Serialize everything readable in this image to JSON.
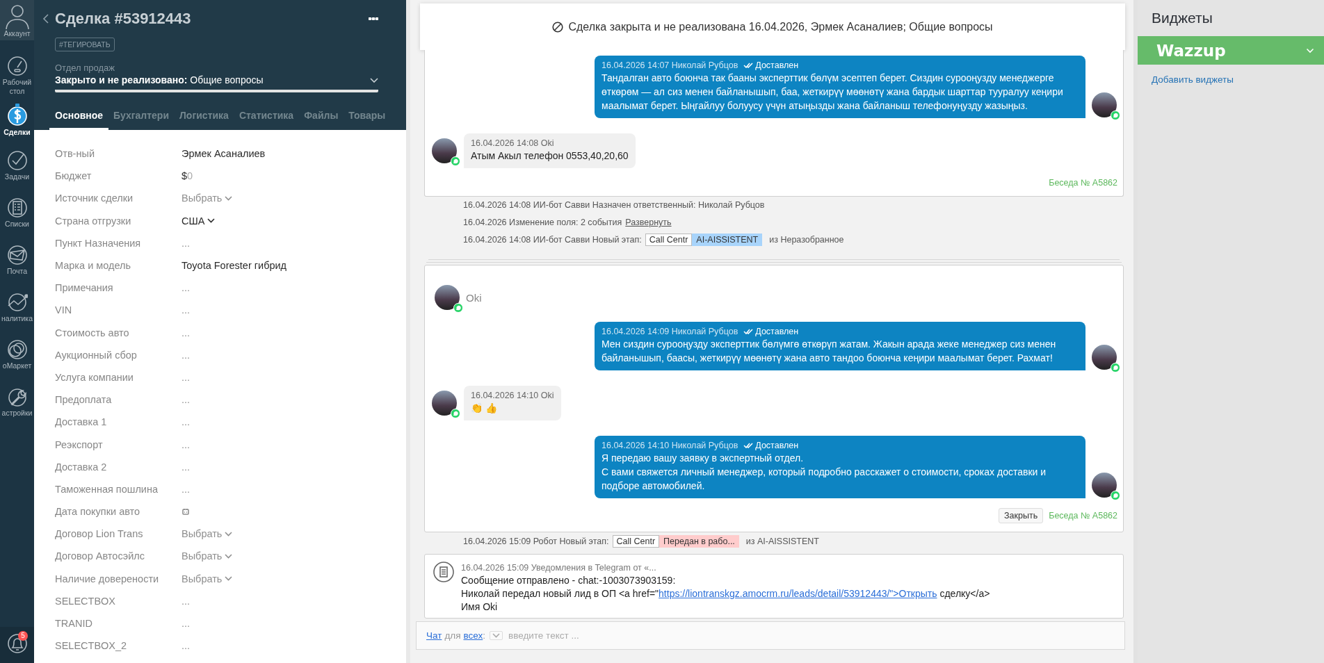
{
  "nav": {
    "items": [
      {
        "kind": "account",
        "label": "Аккаунт",
        "selected": false
      },
      {
        "kind": "dashboard",
        "label": "Рабочий стол",
        "selected": false
      },
      {
        "kind": "leads",
        "label": "Сделки",
        "selected": true
      },
      {
        "kind": "tasks",
        "label": "Задачи",
        "selected": false
      },
      {
        "kind": "lists",
        "label": "Списки",
        "selected": false
      },
      {
        "kind": "mail",
        "label": "Почта",
        "selected": false
      },
      {
        "kind": "analytics",
        "label": "налитика",
        "selected": false
      },
      {
        "kind": "market",
        "label": "оМаркет",
        "selected": false
      },
      {
        "kind": "settings",
        "label": "астройки",
        "selected": false
      }
    ],
    "notifications": {
      "badge": "5"
    }
  },
  "deal": {
    "title": "Сделка #53912443",
    "tag_button": "#ТЕГИРОВАТЬ",
    "pipeline": "Отдел продаж",
    "status": "**Закрыто и не реализовано:** Общие вопросы",
    "tabs": [
      {
        "label": "Основное",
        "selected": true
      },
      {
        "label": "Бухгалтери",
        "selected": false
      },
      {
        "label": "Логистика",
        "selected": false
      },
      {
        "label": "Статистика",
        "selected": false
      },
      {
        "label": "Файлы",
        "selected": false
      },
      {
        "label": "Товары",
        "selected": false
      }
    ],
    "fields": [
      {
        "label": "Отв-ный",
        "kind": "text",
        "value": "Эрмек Асаналиев"
      },
      {
        "label": "Бюджет",
        "kind": "money",
        "currency": "$",
        "value": "0"
      },
      {
        "label": "Источник сделки",
        "kind": "select_empty",
        "placeholder": "Выбрать"
      },
      {
        "label": "Страна отгрузки",
        "kind": "select",
        "value": "США"
      },
      {
        "label": "Пункт Назначения",
        "kind": "empty",
        "placeholder": "..."
      },
      {
        "label": "Марка и модель",
        "kind": "text",
        "value": "Toyota Forester гибрид"
      },
      {
        "label": "Примечания",
        "kind": "empty",
        "placeholder": "..."
      },
      {
        "label": "VIN",
        "kind": "empty",
        "placeholder": "..."
      },
      {
        "label": "Стоимость авто",
        "kind": "empty",
        "placeholder": "..."
      },
      {
        "label": "Аукционный сбор",
        "kind": "empty",
        "placeholder": "..."
      },
      {
        "label": "Услуга компании",
        "kind": "empty",
        "placeholder": "..."
      },
      {
        "label": "Предоплата",
        "kind": "empty",
        "placeholder": "..."
      },
      {
        "label": "Доставка 1",
        "kind": "empty",
        "placeholder": "..."
      },
      {
        "label": "Реэкспорт",
        "kind": "empty",
        "placeholder": "..."
      },
      {
        "label": "Доставка 2",
        "kind": "empty",
        "placeholder": "..."
      },
      {
        "label": "Таможенная пошлина",
        "kind": "empty",
        "placeholder": "..."
      },
      {
        "label": "Дата покупки авто",
        "kind": "date"
      },
      {
        "label": "Договор Lion Trans",
        "kind": "select_empty",
        "placeholder": "Выбрать"
      },
      {
        "label": "Договор Автосэйлс",
        "kind": "select_empty",
        "placeholder": "Выбрать"
      },
      {
        "label": "Наличие доверености",
        "kind": "select_empty",
        "placeholder": "Выбрать"
      },
      {
        "label": "SELECTBOX",
        "kind": "empty",
        "placeholder": "..."
      },
      {
        "label": "TRANID",
        "kind": "empty",
        "placeholder": "..."
      },
      {
        "label": "SELECTBOX_2",
        "kind": "empty",
        "placeholder": "..."
      }
    ]
  },
  "feed": {
    "notice": "Сделка закрыта и не реализована 16.04.2026, Эрмек Асаналиев; Общие вопросы",
    "items": [
      {
        "kind": "chat",
        "stacked": false,
        "messages": [
          {
            "kind": "outgoing",
            "meta": "16.04.2026 14:07 Николай Рубцов",
            "status": "Доставлен",
            "text": "Тандалган авто боюнча так бааны эксперттик бөлүм эсептеп берет. Сиздин сурооңузду менеджерге өткөрөм — ал сиз менен байланышып, баа, жеткирүү мөөнөтү жана бардык шарттар тууралуу кеңири маалымат берет. Ыңгайлуу болуусу үчүн атыңызды жана байланыш телефонуңузду жазыңыз."
          },
          {
            "kind": "incoming",
            "meta": "16.04.2026 14:08 Oki",
            "text": "Атым Акыл телефон 0553,40,20,60"
          }
        ],
        "conversation": "Беседа № A5862"
      },
      {
        "kind": "event",
        "text": "16.04.2026 14:08 ИИ-бот Савви Назначен ответственный: Николай Рубцов"
      },
      {
        "kind": "event",
        "text": "16.04.2026 Изменение поля: 2 события",
        "link": "Развернуть"
      },
      {
        "kind": "stage",
        "text": "16.04.2026 14:08 ИИ-бот Савви Новый этап:",
        "stages": [
          {
            "label": "Call Centr",
            "color": "#ffffff"
          },
          {
            "label": "AI-AISSISTENT",
            "color": "#a8d4fb"
          }
        ],
        "suffix": "из Неразобранное"
      },
      {
        "kind": "chat",
        "stacked": true,
        "contact": "Oki",
        "messages": [
          {
            "kind": "outgoing",
            "meta": "16.04.2026 14:09 Николай Рубцов",
            "status": "Доставлен",
            "text": "Мен сиздин сурооңузду эксперттик бөлүмгө өткөрүп жатам. Жакын арада жеке менеджер сиз менен байланышып, баасы, жеткирүү мөөнөтү жана авто тандоо боюнча кеңири маалымат берет. Рахмат!"
          },
          {
            "kind": "incoming",
            "meta": "16.04.2026 14:10 Oki",
            "text": "👏 👍"
          },
          {
            "kind": "outgoing",
            "meta": "16.04.2026 14:10 Николай Рубцов",
            "status": "Доставлен",
            "text": "Я передаю вашу заявку в экспертный отдел.\nС вами свяжется личный менеджер, который подробно расскажет о стоимости, сроках доставки и подборе автомобилей."
          }
        ],
        "close_button": "Закрыть",
        "conversation": "Беседа № A5862"
      },
      {
        "kind": "stage",
        "text": "16.04.2026 15:09 Робот Новый этап:",
        "stages": [
          {
            "label": "Call Centr",
            "color": "#ffffff"
          },
          {
            "label": "Передан в рабо...",
            "color": "#ffcccc"
          }
        ],
        "suffix": "из AI-AISSISTENT"
      },
      {
        "kind": "note",
        "meta": "16.04.2026 15:09 Уведомления в Telegram от «...",
        "lines": [
          {
            "text": "Сообщение отправлено - chat:-1003073903159:"
          },
          {
            "text": "Николай передал новый лид в ОП <a href=\"",
            "link": "https://liontranskgz.amocrm.ru/leads/detail/53912443/\">Открыть",
            "after": "сделку</a>"
          },
          {
            "text": "Имя Oki"
          }
        ]
      }
    ],
    "composer": {
      "chat_link": "Чат",
      "for_label": "для",
      "audience_link": "всех",
      "separator": ":",
      "placeholder": "введите текст ..."
    }
  },
  "widgets": {
    "title": "Виджеты",
    "items": [
      {
        "name": "Wazzup",
        "color": "#66bb6a"
      }
    ],
    "add_link": "Добавить виджеты"
  }
}
